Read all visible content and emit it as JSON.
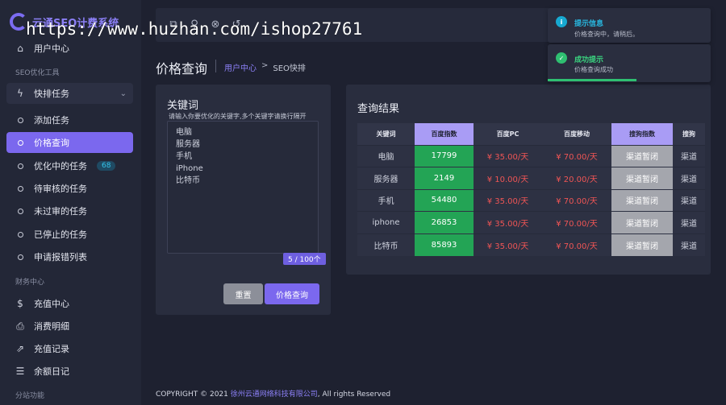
{
  "app": {
    "logo_text": "云通SEO计费系统"
  },
  "watermark": "https://www.huzhan.com/ishop27761",
  "sidebar": {
    "user_center": "用户中心",
    "section_seo": "SEO优化工具",
    "group_label": "快排任务",
    "items": [
      {
        "label": "添加任务"
      },
      {
        "label": "价格查询"
      },
      {
        "label": "优化中的任务",
        "badge": "68"
      },
      {
        "label": "待审核的任务"
      },
      {
        "label": "未过审的任务"
      },
      {
        "label": "已停止的任务"
      },
      {
        "label": "申请报错列表"
      }
    ],
    "section_finance": "财务中心",
    "finance_items": [
      {
        "label": "充值中心"
      },
      {
        "label": "消费明细"
      },
      {
        "label": "充值记录"
      },
      {
        "label": "余额日记"
      }
    ],
    "section_split": "分站功能"
  },
  "header": {
    "page_title": "价格查询",
    "breadcrumb_link": "用户中心",
    "breadcrumb_sep": ">",
    "breadcrumb_current": "SEO快排"
  },
  "keyword_card": {
    "label": "关键词",
    "hint": "请输入你要优化的关键字,多个关键字请换行隔开",
    "keywords": [
      "电脑",
      "服务器",
      "手机",
      "iPhone",
      "比特币"
    ],
    "count": "5 / 100个",
    "reset_label": "重置",
    "query_label": "价格查询"
  },
  "results": {
    "title": "查询结果",
    "columns": [
      "关键词",
      "百度指数",
      "百度PC",
      "百度移动",
      "搜狗指数",
      "搜狗"
    ],
    "rows": [
      {
        "keyword": "电脑",
        "baidu_index": "17799",
        "baidu_pc": "¥ 35.00/天",
        "baidu_mobile": "¥ 70.00/天",
        "sogou_index": "渠道暂闭",
        "sogou": "渠道"
      },
      {
        "keyword": "服务器",
        "baidu_index": "2149",
        "baidu_pc": "¥ 10.00/天",
        "baidu_mobile": "¥ 20.00/天",
        "sogou_index": "渠道暂闭",
        "sogou": "渠道"
      },
      {
        "keyword": "手机",
        "baidu_index": "54480",
        "baidu_pc": "¥ 35.00/天",
        "baidu_mobile": "¥ 70.00/天",
        "sogou_index": "渠道暂闭",
        "sogou": "渠道"
      },
      {
        "keyword": "iphone",
        "baidu_index": "26853",
        "baidu_pc": "¥ 35.00/天",
        "baidu_mobile": "¥ 70.00/天",
        "sogou_index": "渠道暂闭",
        "sogou": "渠道"
      },
      {
        "keyword": "比特币",
        "baidu_index": "85893",
        "baidu_pc": "¥ 35.00/天",
        "baidu_mobile": "¥ 70.00/天",
        "sogou_index": "渠道暂闭",
        "sogou": "渠道"
      }
    ]
  },
  "notifications": [
    {
      "title": "提示信息",
      "message": "价格查询中，请稍后。"
    },
    {
      "title": "成功提示",
      "message": "价格查询成功"
    }
  ],
  "footer": {
    "prefix": "COPYRIGHT © 2021",
    "company": "徐州云通网络科技有限公司",
    "suffix": ", All rights Reserved"
  },
  "colors": {
    "accent": "#7b68ee",
    "green": "#23a455",
    "price": "#f05555",
    "info": "#17a9d1",
    "success": "#2fbf71"
  }
}
